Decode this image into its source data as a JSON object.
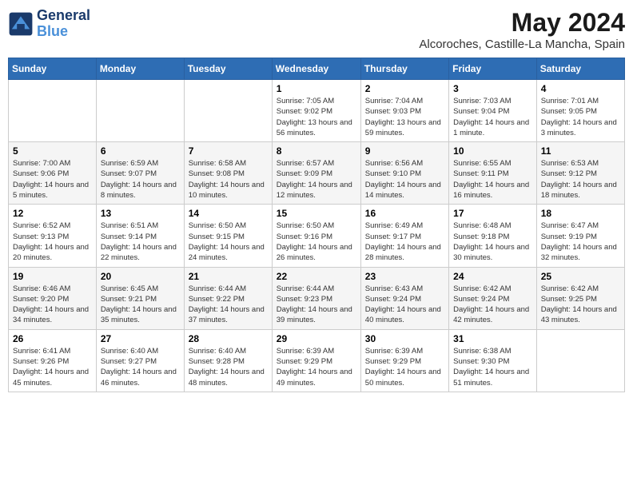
{
  "header": {
    "logo_line1": "General",
    "logo_line2": "Blue",
    "month": "May 2024",
    "location": "Alcoroches, Castille-La Mancha, Spain"
  },
  "days_of_week": [
    "Sunday",
    "Monday",
    "Tuesday",
    "Wednesday",
    "Thursday",
    "Friday",
    "Saturday"
  ],
  "weeks": [
    [
      {
        "day": "",
        "info": ""
      },
      {
        "day": "",
        "info": ""
      },
      {
        "day": "",
        "info": ""
      },
      {
        "day": "1",
        "info": "Sunrise: 7:05 AM\nSunset: 9:02 PM\nDaylight: 13 hours and 56 minutes."
      },
      {
        "day": "2",
        "info": "Sunrise: 7:04 AM\nSunset: 9:03 PM\nDaylight: 13 hours and 59 minutes."
      },
      {
        "day": "3",
        "info": "Sunrise: 7:03 AM\nSunset: 9:04 PM\nDaylight: 14 hours and 1 minute."
      },
      {
        "day": "4",
        "info": "Sunrise: 7:01 AM\nSunset: 9:05 PM\nDaylight: 14 hours and 3 minutes."
      }
    ],
    [
      {
        "day": "5",
        "info": "Sunrise: 7:00 AM\nSunset: 9:06 PM\nDaylight: 14 hours and 5 minutes."
      },
      {
        "day": "6",
        "info": "Sunrise: 6:59 AM\nSunset: 9:07 PM\nDaylight: 14 hours and 8 minutes."
      },
      {
        "day": "7",
        "info": "Sunrise: 6:58 AM\nSunset: 9:08 PM\nDaylight: 14 hours and 10 minutes."
      },
      {
        "day": "8",
        "info": "Sunrise: 6:57 AM\nSunset: 9:09 PM\nDaylight: 14 hours and 12 minutes."
      },
      {
        "day": "9",
        "info": "Sunrise: 6:56 AM\nSunset: 9:10 PM\nDaylight: 14 hours and 14 minutes."
      },
      {
        "day": "10",
        "info": "Sunrise: 6:55 AM\nSunset: 9:11 PM\nDaylight: 14 hours and 16 minutes."
      },
      {
        "day": "11",
        "info": "Sunrise: 6:53 AM\nSunset: 9:12 PM\nDaylight: 14 hours and 18 minutes."
      }
    ],
    [
      {
        "day": "12",
        "info": "Sunrise: 6:52 AM\nSunset: 9:13 PM\nDaylight: 14 hours and 20 minutes."
      },
      {
        "day": "13",
        "info": "Sunrise: 6:51 AM\nSunset: 9:14 PM\nDaylight: 14 hours and 22 minutes."
      },
      {
        "day": "14",
        "info": "Sunrise: 6:50 AM\nSunset: 9:15 PM\nDaylight: 14 hours and 24 minutes."
      },
      {
        "day": "15",
        "info": "Sunrise: 6:50 AM\nSunset: 9:16 PM\nDaylight: 14 hours and 26 minutes."
      },
      {
        "day": "16",
        "info": "Sunrise: 6:49 AM\nSunset: 9:17 PM\nDaylight: 14 hours and 28 minutes."
      },
      {
        "day": "17",
        "info": "Sunrise: 6:48 AM\nSunset: 9:18 PM\nDaylight: 14 hours and 30 minutes."
      },
      {
        "day": "18",
        "info": "Sunrise: 6:47 AM\nSunset: 9:19 PM\nDaylight: 14 hours and 32 minutes."
      }
    ],
    [
      {
        "day": "19",
        "info": "Sunrise: 6:46 AM\nSunset: 9:20 PM\nDaylight: 14 hours and 34 minutes."
      },
      {
        "day": "20",
        "info": "Sunrise: 6:45 AM\nSunset: 9:21 PM\nDaylight: 14 hours and 35 minutes."
      },
      {
        "day": "21",
        "info": "Sunrise: 6:44 AM\nSunset: 9:22 PM\nDaylight: 14 hours and 37 minutes."
      },
      {
        "day": "22",
        "info": "Sunrise: 6:44 AM\nSunset: 9:23 PM\nDaylight: 14 hours and 39 minutes."
      },
      {
        "day": "23",
        "info": "Sunrise: 6:43 AM\nSunset: 9:24 PM\nDaylight: 14 hours and 40 minutes."
      },
      {
        "day": "24",
        "info": "Sunrise: 6:42 AM\nSunset: 9:24 PM\nDaylight: 14 hours and 42 minutes."
      },
      {
        "day": "25",
        "info": "Sunrise: 6:42 AM\nSunset: 9:25 PM\nDaylight: 14 hours and 43 minutes."
      }
    ],
    [
      {
        "day": "26",
        "info": "Sunrise: 6:41 AM\nSunset: 9:26 PM\nDaylight: 14 hours and 45 minutes."
      },
      {
        "day": "27",
        "info": "Sunrise: 6:40 AM\nSunset: 9:27 PM\nDaylight: 14 hours and 46 minutes."
      },
      {
        "day": "28",
        "info": "Sunrise: 6:40 AM\nSunset: 9:28 PM\nDaylight: 14 hours and 48 minutes."
      },
      {
        "day": "29",
        "info": "Sunrise: 6:39 AM\nSunset: 9:29 PM\nDaylight: 14 hours and 49 minutes."
      },
      {
        "day": "30",
        "info": "Sunrise: 6:39 AM\nSunset: 9:29 PM\nDaylight: 14 hours and 50 minutes."
      },
      {
        "day": "31",
        "info": "Sunrise: 6:38 AM\nSunset: 9:30 PM\nDaylight: 14 hours and 51 minutes."
      },
      {
        "day": "",
        "info": ""
      }
    ]
  ]
}
